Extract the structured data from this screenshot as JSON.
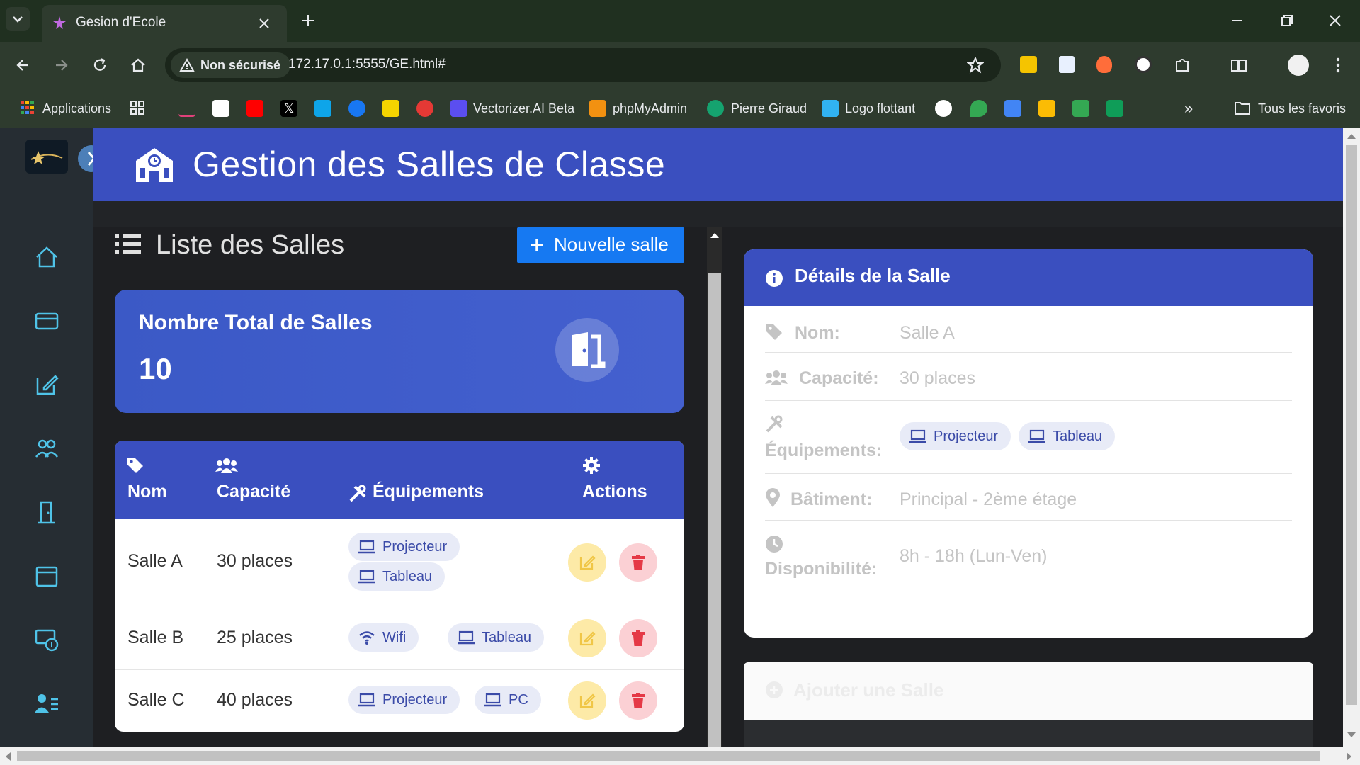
{
  "browser": {
    "tab_title": "Gesion d'Ecole",
    "security_label": "Non sécurisé",
    "url": "172.17.0.1:5555/GE.html#",
    "bookmarks": [
      "Applications",
      "Vectorizer.AI Beta",
      "phpMyAdmin",
      "Pierre Giraud",
      "Logo flottant"
    ],
    "all_bookmarks_label": "Tous les favoris",
    "overflow_label": "»"
  },
  "header": {
    "title": "Gestion des Salles de Classe"
  },
  "list": {
    "title": "Liste des Salles",
    "new_button": "Nouvelle salle"
  },
  "stat": {
    "label": "Nombre Total de Salles",
    "value": "10"
  },
  "table": {
    "headers": [
      "Nom",
      "Capacité",
      "Équipements",
      "Actions"
    ],
    "rows": [
      {
        "name": "Salle A",
        "capacity": "30 places",
        "equipment": [
          "Projecteur",
          "Tableau"
        ]
      },
      {
        "name": "Salle B",
        "capacity": "25 places",
        "equipment": [
          "Wifi",
          "Tableau"
        ]
      },
      {
        "name": "Salle C",
        "capacity": "40 places",
        "equipment": [
          "Projecteur",
          "PC"
        ]
      }
    ]
  },
  "details": {
    "title": "Détails de la Salle",
    "name_label": "Nom:",
    "name_value": "Salle A",
    "capacity_label": "Capacité:",
    "capacity_value": "30 places",
    "equipment_label": "Équipements:",
    "equipment": [
      "Projecteur",
      "Tableau"
    ],
    "building_label": "Bâtiment:",
    "building_value": "Principal - 2ème étage",
    "availability_label": "Disponibilité:",
    "availability_value": "8h - 18h (Lun-Ven)"
  },
  "add_form": {
    "title": "Ajouter une Salle"
  },
  "colors": {
    "primary": "#3a4fbf",
    "button": "#1679f2",
    "edit": "#fdeaa7",
    "delete": "#fbd0d4",
    "sidebar_icon": "#4fc3e8"
  }
}
